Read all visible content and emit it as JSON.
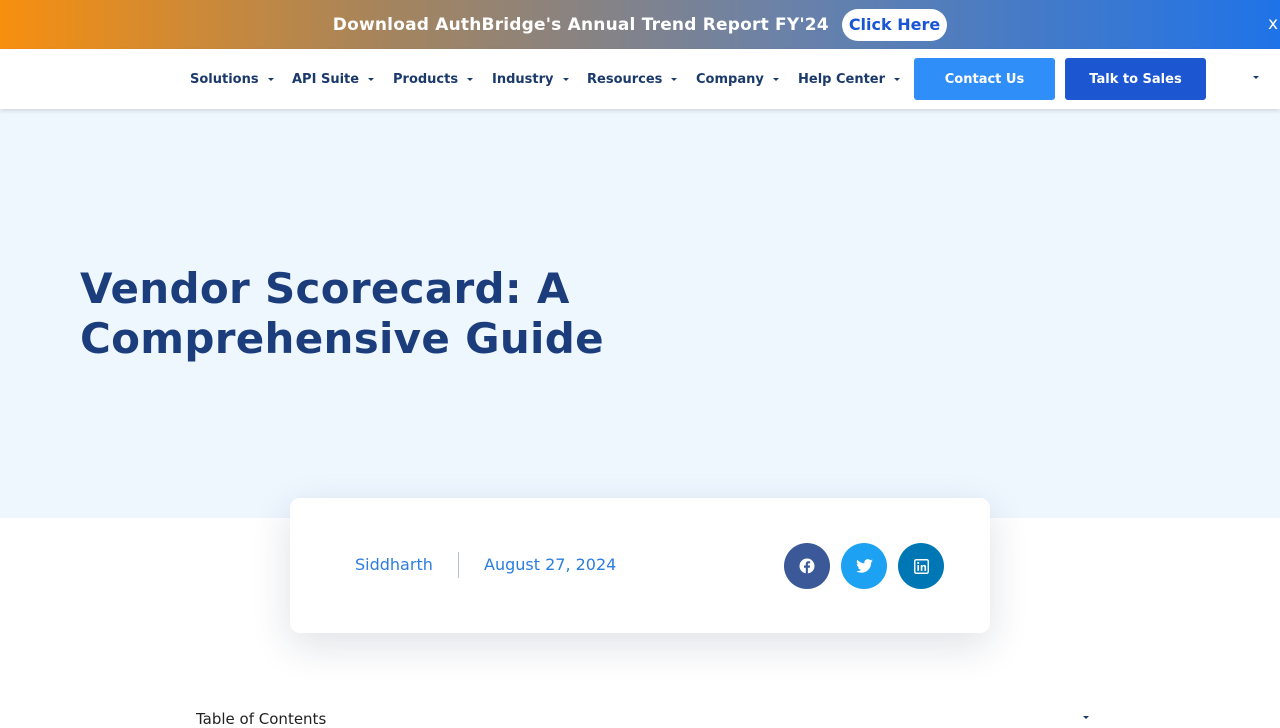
{
  "promo": {
    "text": "Download AuthBridge's Annual Trend Report FY'24",
    "cta": "Click Here",
    "close": "x"
  },
  "nav": {
    "items": [
      {
        "label": "Solutions"
      },
      {
        "label": "API Suite"
      },
      {
        "label": "Products"
      },
      {
        "label": "Industry"
      },
      {
        "label": "Resources"
      },
      {
        "label": "Company"
      },
      {
        "label": "Help Center"
      }
    ],
    "contact_label": "Contact Us",
    "sales_label": "Talk to Sales"
  },
  "article": {
    "title": "Vendor Scorecard: A Comprehensive Guide",
    "author": "Siddharth",
    "date": "August 27, 2024",
    "share": [
      "facebook-icon",
      "twitter-icon",
      "linkedin-icon"
    ]
  },
  "toc": {
    "label": "Table of Contents"
  },
  "colors": {
    "title": "#1b3d7c",
    "hero_bg": "#eef6fe",
    "contact_btn": "#2f8ef7",
    "sales_btn": "#1c56d0",
    "link": "#2b7de0"
  }
}
